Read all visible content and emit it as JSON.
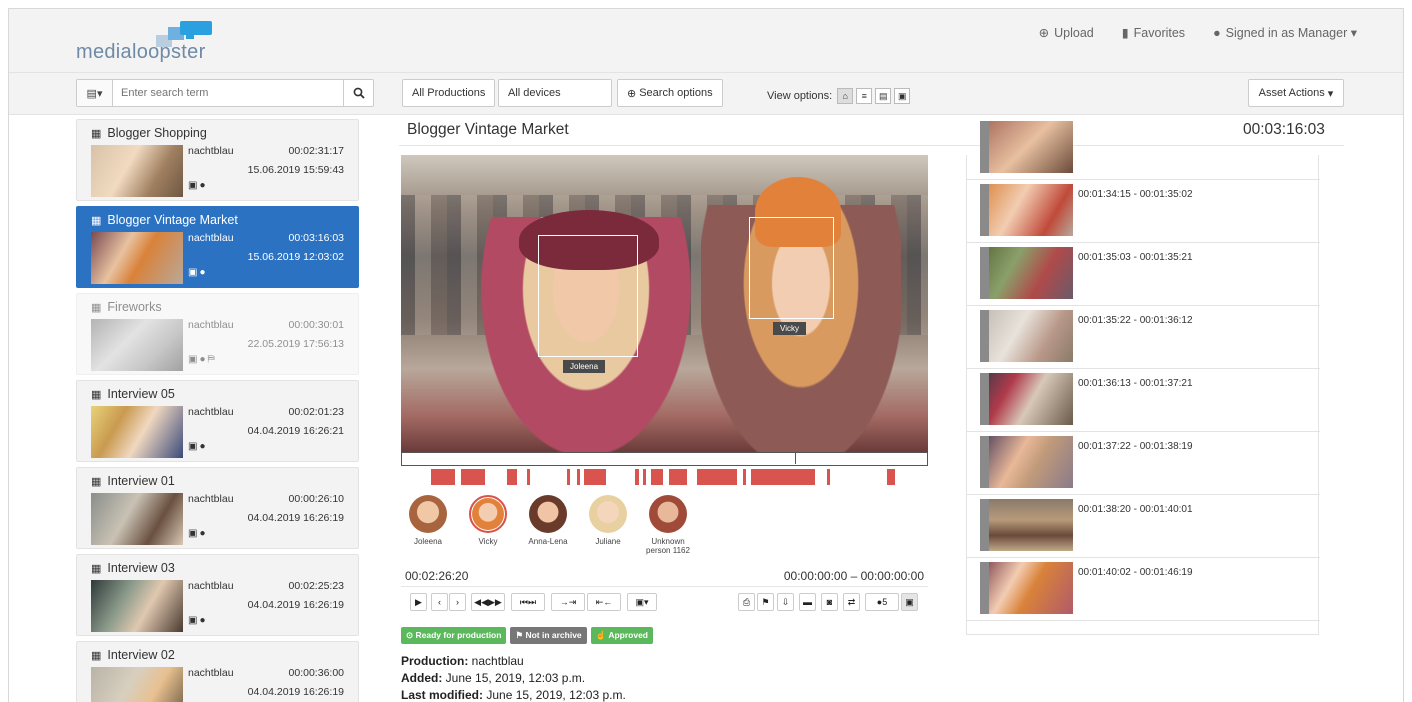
{
  "header": {
    "logo_text": "medialoopster",
    "nav": [
      {
        "icon": "upload-icon",
        "label": "Upload"
      },
      {
        "icon": "bookmark-icon",
        "label": "Favorites"
      },
      {
        "icon": "user-icon",
        "label": "Signed in as Manager"
      }
    ]
  },
  "toolbar": {
    "search_placeholder": "Enter search term",
    "filter_productions": "All Productions",
    "filter_devices": "All devices",
    "search_options": "Search options",
    "view_options_label": "View options:",
    "asset_actions": "Asset Actions"
  },
  "sidebar": {
    "assets": [
      {
        "title": "Blogger Shopping",
        "owner": "nachtblau",
        "duration": "00:02:31:17",
        "date": "15.06.2019 15:59:43",
        "state": "normal"
      },
      {
        "title": "Blogger Vintage Market",
        "owner": "nachtblau",
        "duration": "00:03:16:03",
        "date": "15.06.2019 12:03:02",
        "state": "active"
      },
      {
        "title": "Fireworks",
        "owner": "nachtblau",
        "duration": "00:00:30:01",
        "date": "22.05.2019 17:56:13",
        "state": "dim"
      },
      {
        "title": "Interview 05",
        "owner": "nachtblau",
        "duration": "00:02:01:23",
        "date": "04.04.2019 16:26:21",
        "state": "normal"
      },
      {
        "title": "Interview 01",
        "owner": "nachtblau",
        "duration": "00:00:26:10",
        "date": "04.04.2019 16:26:19",
        "state": "normal"
      },
      {
        "title": "Interview 03",
        "owner": "nachtblau",
        "duration": "00:02:25:23",
        "date": "04.04.2019 16:26:19",
        "state": "normal"
      },
      {
        "title": "Interview 02",
        "owner": "nachtblau",
        "duration": "00:00:36:00",
        "date": "04.04.2019 16:26:19",
        "state": "normal"
      }
    ]
  },
  "main": {
    "title": "Blogger Vintage Market",
    "duration": "00:03:16:03",
    "faces": [
      {
        "label": "Joleena"
      },
      {
        "label": "Vicky"
      }
    ],
    "persons": [
      {
        "name": "Joleena",
        "selected": false
      },
      {
        "name": "Vicky",
        "selected": true
      },
      {
        "name": "Anna-Lena",
        "selected": false
      },
      {
        "name": "Juliane",
        "selected": false
      },
      {
        "name": "Unknown person 1162",
        "selected": false
      }
    ],
    "current_time": "00:02:26:20",
    "range": "00:00:00:00 – 00:00:00:00",
    "person_count": "5",
    "badges": [
      {
        "label": "Ready for production",
        "color": "#5cb85c",
        "icon": "check-circle-icon"
      },
      {
        "label": "Not in archive",
        "color": "#777777",
        "icon": "archive-icon"
      },
      {
        "label": "Approved",
        "color": "#5cb85c",
        "icon": "thumbs-up-icon"
      }
    ],
    "meta": {
      "production_label": "Production:",
      "production_value": "nachtblau",
      "added_label": "Added:",
      "added_value": "June 15, 2019, 12:03 p.m.",
      "modified_label": "Last modified:",
      "modified_value": "June 15, 2019, 12:03 p.m."
    }
  },
  "shots": [
    {
      "range": ""
    },
    {
      "range": "00:01:34:15 - 00:01:35:02"
    },
    {
      "range": "00:01:35:03 - 00:01:35:21"
    },
    {
      "range": "00:01:35:22 - 00:01:36:12"
    },
    {
      "range": "00:01:36:13 - 00:01:37:21"
    },
    {
      "range": "00:01:37:22 - 00:01:38:19"
    },
    {
      "range": "00:01:38:20 - 00:01:40:01"
    },
    {
      "range": "00:01:40:02 - 00:01:46:19"
    }
  ],
  "colors": {
    "accent": "#2b72c2",
    "timeline_marker": "#d9534f",
    "success": "#5cb85c"
  }
}
